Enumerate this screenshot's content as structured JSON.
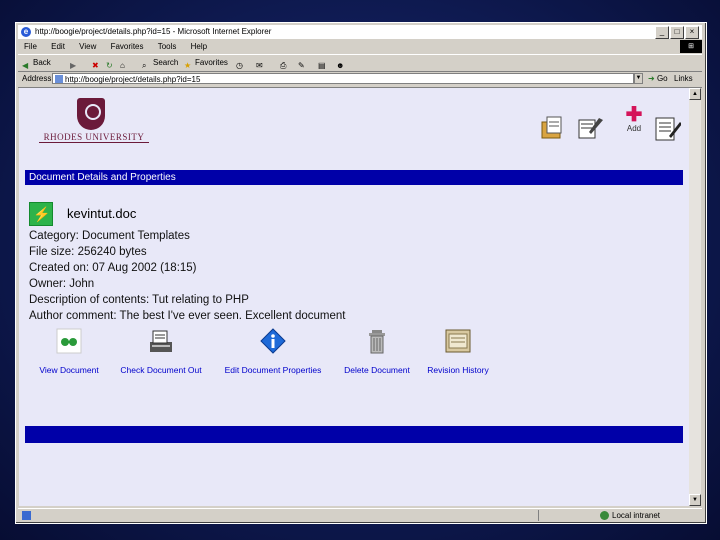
{
  "window": {
    "title": "http://boogie/project/details.php?id=15 - Microsoft Internet Explorer",
    "buttons": {
      "minimize": "_",
      "maximize": "□",
      "close": "×"
    }
  },
  "menu": [
    "File",
    "Edit",
    "View",
    "Favorites",
    "Tools",
    "Help"
  ],
  "toolbar": {
    "back": "Back",
    "search": "Search",
    "favorites": "Favorites"
  },
  "address": {
    "label": "Address",
    "url": "http://boogie/project/details.php?id=15",
    "go": "Go",
    "links": "Links"
  },
  "logo": {
    "name": "RHODES UNIVERSITY"
  },
  "icons": {
    "add_label": "Add"
  },
  "section_title": "Document Details and Properties",
  "document": {
    "name": "kevintut.doc",
    "properties": [
      "Category: Document Templates",
      "File size: 256240 bytes",
      "Created on: 07 Aug 2002 (18:15)",
      "Owner: John",
      "Description of contents: Tut relating to PHP",
      "Author comment: The best I've ever seen. Excellent document"
    ]
  },
  "actions": [
    {
      "label": "View Document",
      "icon": "view-icon"
    },
    {
      "label": "Check Document Out",
      "icon": "checkout-icon"
    },
    {
      "label": "Edit Document Properties",
      "icon": "info-icon"
    },
    {
      "label": "Delete Document",
      "icon": "trash-icon"
    },
    {
      "label": "Revision History",
      "icon": "history-icon"
    }
  ],
  "status": {
    "zone": "Local intranet"
  },
  "colors": {
    "header_bar": "#0000a8",
    "link": "#0000cc",
    "brand": "#6b1a3a"
  }
}
